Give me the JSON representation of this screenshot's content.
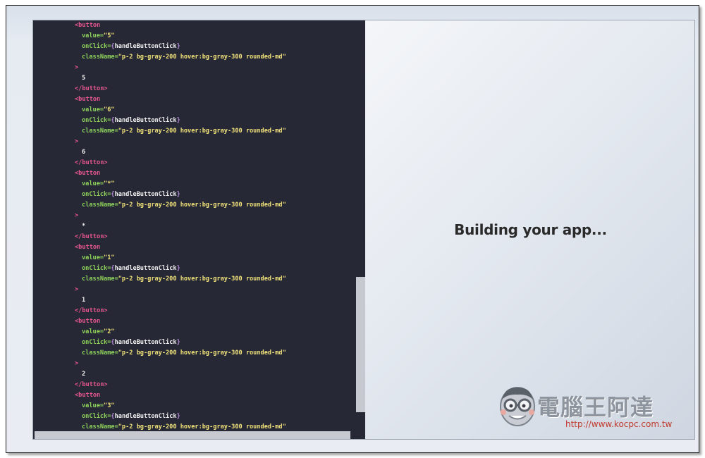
{
  "editor": {
    "lines": [
      {
        "indent": 1,
        "kind": "tag",
        "text": "<button"
      },
      {
        "indent": 2,
        "kind": "attr",
        "name": "value=",
        "value": "\"5\""
      },
      {
        "indent": 2,
        "kind": "handler",
        "name": "onClick=",
        "open": "{",
        "value": "handleButtonClick",
        "close": "}"
      },
      {
        "indent": 2,
        "kind": "attr",
        "name": "className=",
        "value": "\"p-2 bg-gray-200 hover:bg-gray-300 rounded-md\""
      },
      {
        "indent": 1,
        "kind": "tag",
        "text": ">"
      },
      {
        "indent": 2,
        "kind": "text",
        "text": "5"
      },
      {
        "indent": 1,
        "kind": "tag",
        "text": "</button>"
      },
      {
        "indent": 1,
        "kind": "tag",
        "text": "<button"
      },
      {
        "indent": 2,
        "kind": "attr",
        "name": "value=",
        "value": "\"6\""
      },
      {
        "indent": 2,
        "kind": "handler",
        "name": "onClick=",
        "open": "{",
        "value": "handleButtonClick",
        "close": "}"
      },
      {
        "indent": 2,
        "kind": "attr",
        "name": "className=",
        "value": "\"p-2 bg-gray-200 hover:bg-gray-300 rounded-md\""
      },
      {
        "indent": 1,
        "kind": "tag",
        "text": ">"
      },
      {
        "indent": 2,
        "kind": "text",
        "text": "6"
      },
      {
        "indent": 1,
        "kind": "tag",
        "text": "</button>"
      },
      {
        "indent": 1,
        "kind": "tag",
        "text": "<button"
      },
      {
        "indent": 2,
        "kind": "attr",
        "name": "value=",
        "value": "\"*\""
      },
      {
        "indent": 2,
        "kind": "handler",
        "name": "onClick=",
        "open": "{",
        "value": "handleButtonClick",
        "close": "}"
      },
      {
        "indent": 2,
        "kind": "attr",
        "name": "className=",
        "value": "\"p-2 bg-gray-200 hover:bg-gray-300 rounded-md\""
      },
      {
        "indent": 1,
        "kind": "tag",
        "text": ">"
      },
      {
        "indent": 2,
        "kind": "text",
        "text": "*"
      },
      {
        "indent": 1,
        "kind": "tag",
        "text": "</button>"
      },
      {
        "indent": 1,
        "kind": "tag",
        "text": "<button"
      },
      {
        "indent": 2,
        "kind": "attr",
        "name": "value=",
        "value": "\"1\""
      },
      {
        "indent": 2,
        "kind": "handler",
        "name": "onClick=",
        "open": "{",
        "value": "handleButtonClick",
        "close": "}"
      },
      {
        "indent": 2,
        "kind": "attr",
        "name": "className=",
        "value": "\"p-2 bg-gray-200 hover:bg-gray-300 rounded-md\""
      },
      {
        "indent": 1,
        "kind": "tag",
        "text": ">"
      },
      {
        "indent": 2,
        "kind": "text",
        "text": "1"
      },
      {
        "indent": 1,
        "kind": "tag",
        "text": "</button>"
      },
      {
        "indent": 1,
        "kind": "tag",
        "text": "<button"
      },
      {
        "indent": 2,
        "kind": "attr",
        "name": "value=",
        "value": "\"2\""
      },
      {
        "indent": 2,
        "kind": "handler",
        "name": "onClick=",
        "open": "{",
        "value": "handleButtonClick",
        "close": "}"
      },
      {
        "indent": 2,
        "kind": "attr",
        "name": "className=",
        "value": "\"p-2 bg-gray-200 hover:bg-gray-300 rounded-md\""
      },
      {
        "indent": 1,
        "kind": "tag",
        "text": ">"
      },
      {
        "indent": 2,
        "kind": "text",
        "text": "2"
      },
      {
        "indent": 1,
        "kind": "tag",
        "text": "</button>"
      },
      {
        "indent": 1,
        "kind": "tag",
        "text": "<button"
      },
      {
        "indent": 2,
        "kind": "attr",
        "name": "value=",
        "value": "\"3\""
      },
      {
        "indent": 2,
        "kind": "handler",
        "name": "onClick=",
        "open": "{",
        "value": "handleButtonClick",
        "close": "}"
      },
      {
        "indent": 2,
        "kind": "attr",
        "name": "className=",
        "value": "\"p-2 bg-gray-200 hover:bg-gray-300 rounded-md\""
      },
      {
        "indent": 1,
        "kind": "tag",
        "text": ">"
      }
    ]
  },
  "preview": {
    "status_text": "Building your app..."
  },
  "watermark": {
    "title": "電腦王阿達",
    "url": "http://www.kocpc.com.tw"
  },
  "colors": {
    "editor_bg": "#272835",
    "tag": "#e8578f",
    "attr": "#8fd35c",
    "string": "#f0e27a",
    "brace": "#b58cd9"
  },
  "icons": {
    "watermark_mascot": "glasses-face-icon"
  }
}
